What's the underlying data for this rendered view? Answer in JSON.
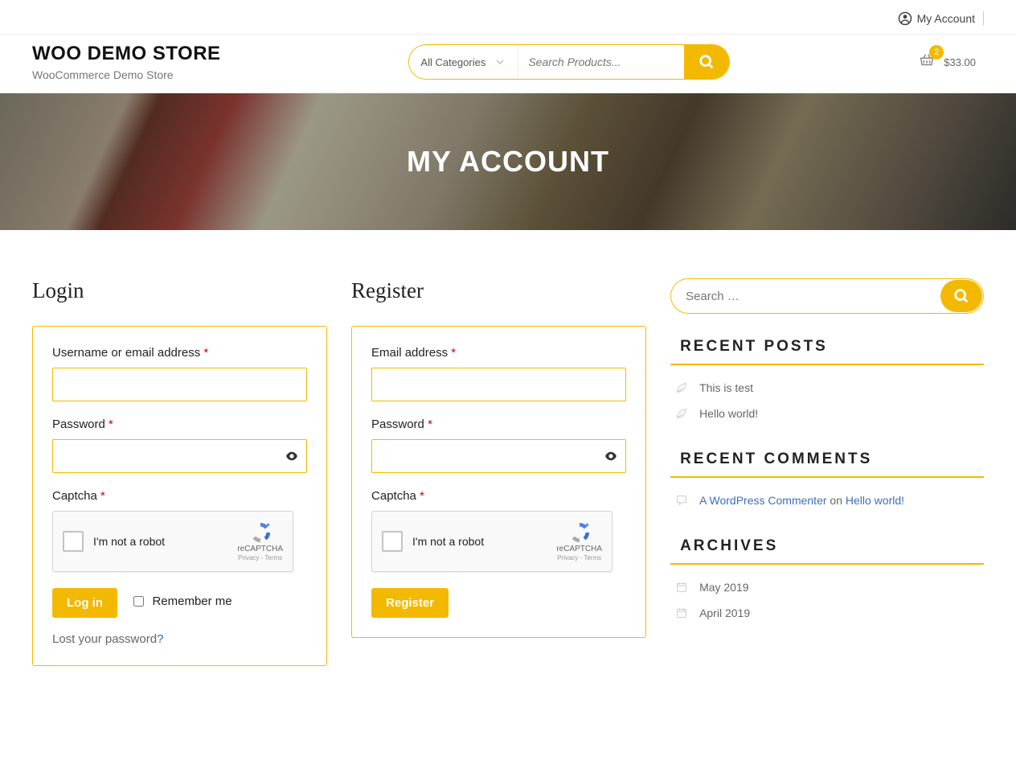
{
  "topbar": {
    "account_label": "My Account"
  },
  "brand": {
    "title": "WOO DEMO STORE",
    "subtitle": "WooCommerce Demo Store"
  },
  "search": {
    "category_label": "All Categories",
    "placeholder": "Search Products..."
  },
  "cart": {
    "count": "2",
    "total": "$33.00"
  },
  "hero": {
    "title": "MY ACCOUNT"
  },
  "login": {
    "heading": "Login",
    "username_label": "Username or email address ",
    "password_label": "Password ",
    "captcha_label": "Captcha ",
    "recaptcha_text": "I'm not a robot",
    "recaptcha_brand": "reCAPTCHA",
    "recaptcha_terms": "Privacy - Terms",
    "button": "Log in",
    "remember": "Remember me",
    "lost": "Lost your password",
    "qmark": "?"
  },
  "register": {
    "heading": "Register",
    "email_label": "Email address ",
    "password_label": "Password ",
    "captcha_label": "Captcha ",
    "recaptcha_text": "I'm not a robot",
    "recaptcha_brand": "reCAPTCHA",
    "recaptcha_terms": "Privacy - Terms",
    "button": "Register"
  },
  "required": "*",
  "sidebar": {
    "search_placeholder": "Search …",
    "recent_posts_title": "RECENT POSTS",
    "recent_posts": [
      "This is test",
      "Hello world!"
    ],
    "recent_comments_title": "RECENT COMMENTS",
    "comment_author": "A WordPress Commenter",
    "comment_on": " on ",
    "comment_post": "Hello world!",
    "archives_title": "ARCHIVES",
    "archives": [
      "May 2019",
      "April 2019"
    ]
  }
}
